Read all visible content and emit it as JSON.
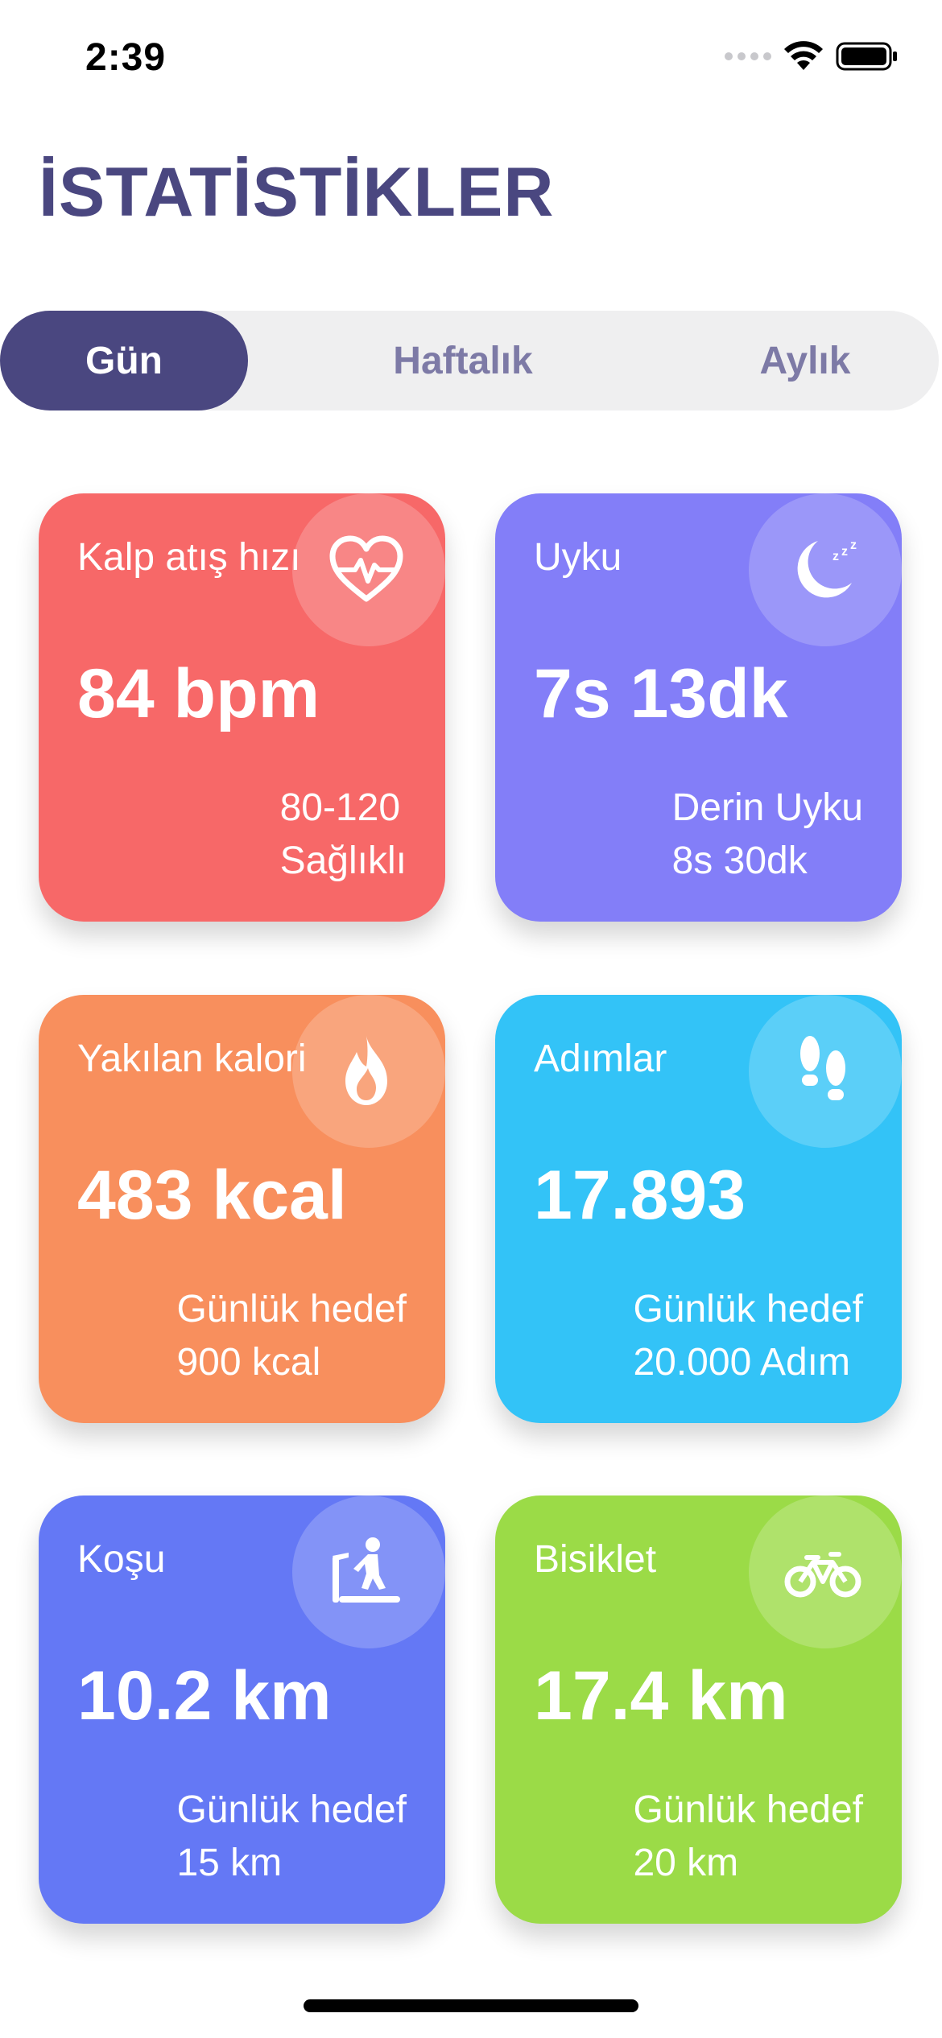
{
  "status_bar": {
    "time": "2:39"
  },
  "page": {
    "title": "İSTATİSTİKLER"
  },
  "tabs": [
    {
      "label": "Gün",
      "active": true
    },
    {
      "label": "Haftalık",
      "active": false
    },
    {
      "label": "Aylık",
      "active": false
    }
  ],
  "cards": [
    {
      "title": "Kalp atış hızı",
      "value": "84 bpm",
      "sub1": "80-120",
      "sub2": "Sağlıklı",
      "color": "#f76868",
      "icon": "heart-pulse-icon"
    },
    {
      "title": "Uyku",
      "value": "7s 13dk",
      "sub1": "Derin Uyku",
      "sub2": "8s 30dk",
      "color": "#837ef8",
      "icon": "moon-sleep-icon"
    },
    {
      "title": "Yakılan kalori",
      "value": "483 kcal",
      "sub1": "Günlük hedef",
      "sub2": "900 kcal",
      "color": "#f88f5d",
      "icon": "flame-icon"
    },
    {
      "title": "Adımlar",
      "value": "17.893",
      "sub1": "Günlük hedef",
      "sub2": "20.000 Adım",
      "color": "#33c3f7",
      "icon": "footsteps-icon"
    },
    {
      "title": "Koşu",
      "value": "10.2 km",
      "sub1": "Günlük hedef",
      "sub2": "15 km",
      "color": "#6478f5",
      "icon": "treadmill-icon"
    },
    {
      "title": "Bisiklet",
      "value": "17.4 km",
      "sub1": "Günlük hedef",
      "sub2": "20 km",
      "color": "#9bdb47",
      "icon": "bicycle-icon"
    }
  ]
}
